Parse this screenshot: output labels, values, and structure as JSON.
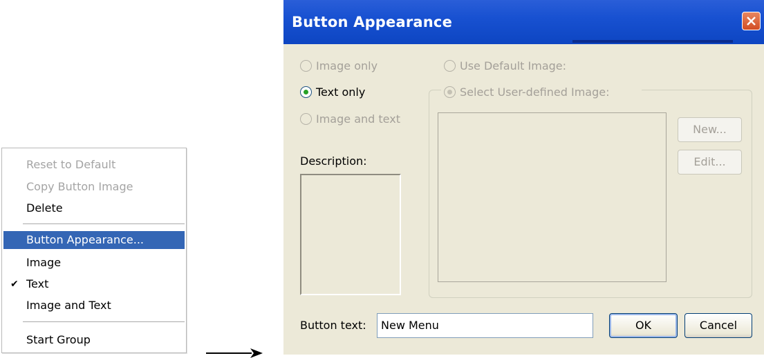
{
  "context_menu": {
    "items": [
      {
        "label": "Reset to Default",
        "enabled": false,
        "checked": false,
        "selected": false
      },
      {
        "label": "Copy Button Image",
        "enabled": false,
        "checked": false,
        "selected": false
      },
      {
        "label": "Delete",
        "enabled": true,
        "checked": false,
        "selected": false
      },
      {
        "label": "Button Appearance...",
        "enabled": true,
        "checked": false,
        "selected": true
      },
      {
        "label": "Image",
        "enabled": true,
        "checked": false,
        "selected": false
      },
      {
        "label": "Text",
        "enabled": true,
        "checked": true,
        "selected": false
      },
      {
        "label": "Image and Text",
        "enabled": true,
        "checked": false,
        "selected": false
      },
      {
        "label": "Start Group",
        "enabled": true,
        "checked": false,
        "selected": false
      }
    ],
    "check_glyph": "✔"
  },
  "dialog": {
    "title": "Button Appearance",
    "close_icon": "close-icon",
    "radios": {
      "image_only": {
        "label": "Image only",
        "enabled": false,
        "checked": false
      },
      "text_only": {
        "label": "Text only",
        "enabled": true,
        "checked": true
      },
      "image_and_text": {
        "label": "Image and text",
        "enabled": false,
        "checked": false
      },
      "use_default_image": {
        "label": "Use Default Image:",
        "enabled": false,
        "checked": false
      },
      "select_user_image": {
        "label": "Select User-defined Image:",
        "enabled": false,
        "checked": true
      }
    },
    "new_button": "New...",
    "edit_button": "Edit...",
    "description_label": "Description:",
    "button_text_label": "Button text:",
    "button_text_value": "New Menu",
    "ok_button": "OK",
    "cancel_button": "Cancel"
  },
  "colors": {
    "selection": "#3466b5",
    "titlebar": "#1851d1",
    "dialog_bg": "#ece9d8",
    "radio_dot": "#26a126",
    "close_button": "#d24d24"
  }
}
